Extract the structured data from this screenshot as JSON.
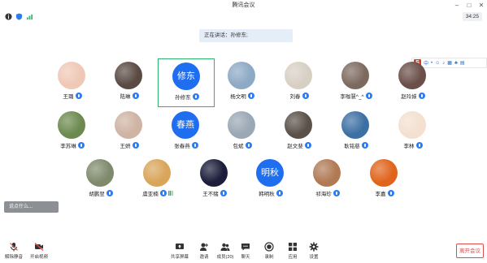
{
  "window": {
    "title": "腾讯会议"
  },
  "timer": "34:25",
  "speaking": {
    "text": "正在讲话：孙修东;"
  },
  "chat_pill": {
    "text": "说点什么..."
  },
  "participants": [
    {
      "name": "王璐",
      "avatar_text": "",
      "avatar_color": "#f0c8b6",
      "mic": true,
      "signal": false
    },
    {
      "name": "陆琳",
      "avatar_text": "",
      "avatar_color": "#5a4a43",
      "mic": true,
      "signal": false
    },
    {
      "name": "孙修东",
      "avatar_text": "修东",
      "avatar_color": "#1f6ef0",
      "mic": true,
      "signal": false,
      "selected": true
    },
    {
      "name": "杨文明",
      "avatar_text": "",
      "avatar_color": "#8da9c4",
      "mic": true,
      "signal": false
    },
    {
      "name": "刘春",
      "avatar_text": "",
      "avatar_color": "#d8cfc4",
      "mic": true,
      "signal": false
    },
    {
      "name": "李咖慧^_^",
      "avatar_text": "",
      "avatar_color": "#7d6a5f",
      "mic": true,
      "signal": false
    },
    {
      "name": "赵玲妹",
      "avatar_text": "",
      "avatar_color": "#6b4f49",
      "mic": true,
      "signal": false
    },
    {
      "name": "李苏琳",
      "avatar_text": "",
      "avatar_color": "#6c8a4f",
      "mic": true,
      "signal": false
    },
    {
      "name": "王妍",
      "avatar_text": "",
      "avatar_color": "#cfb3a3",
      "mic": true,
      "signal": false
    },
    {
      "name": "张春燕",
      "avatar_text": "春燕",
      "avatar_color": "#1f6ef0",
      "mic": true,
      "signal": false
    },
    {
      "name": "包斌",
      "avatar_text": "",
      "avatar_color": "#9aa7b5",
      "mic": true,
      "signal": false
    },
    {
      "name": "赵文斐",
      "avatar_text": "",
      "avatar_color": "#5a5149",
      "mic": true,
      "signal": false
    },
    {
      "name": "耿铭慈",
      "avatar_text": "",
      "avatar_color": "#3c6fa3",
      "mic": true,
      "signal": false
    },
    {
      "name": "李林",
      "avatar_text": "",
      "avatar_color": "#f3e0d0",
      "mic": true,
      "signal": false
    },
    {
      "name": "胡鹏翌",
      "avatar_text": "",
      "avatar_color": "#7f8a6d",
      "mic": true,
      "signal": false
    },
    {
      "name": "虞亚楠",
      "avatar_text": "",
      "avatar_color": "#d9a55a",
      "mic": true,
      "signal": true
    },
    {
      "name": "王不赌",
      "avatar_text": "",
      "avatar_color": "#1b1d3a",
      "mic": true,
      "signal": false
    },
    {
      "name": "韩明秋",
      "avatar_text": "明秋",
      "avatar_color": "#1f6ef0",
      "mic": true,
      "signal": false
    },
    {
      "name": "祁海珍",
      "avatar_text": "",
      "avatar_color": "#b07a54",
      "mic": true,
      "signal": false
    },
    {
      "name": "李嘉",
      "avatar_text": "",
      "avatar_color": "#e0641c",
      "mic": true,
      "signal": false
    }
  ],
  "toolbar": {
    "unmute": "解除静音",
    "start_video": "开启视频",
    "share_screen": "共享屏幕",
    "invite": "邀请",
    "members": "成员(20)",
    "chat": "聊天",
    "record": "录制",
    "apps": "应用",
    "settings": "设置",
    "leave": "离开会议"
  },
  "colors": {
    "accent": "#1f6ef0",
    "selected_border": "#2fb36a",
    "leave": "#e34b4b"
  }
}
